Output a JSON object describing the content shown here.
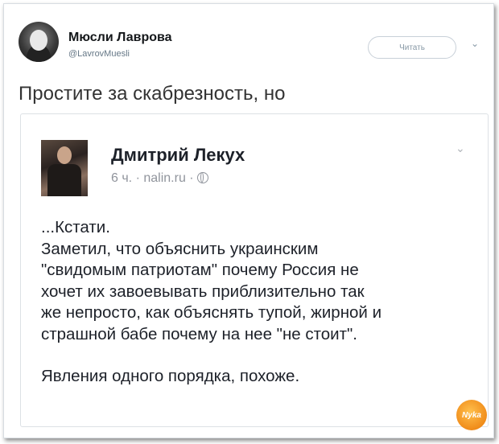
{
  "tweet": {
    "author_name": "Мюсли Лаврова",
    "author_handle": "@LavrovMuesli",
    "follow_label": "Читать",
    "caret": "⌄",
    "text": "Простите за скабрезность, но"
  },
  "quoted_post": {
    "author_name": "Дмитрий Лекух",
    "time": "6 ч.",
    "separator": "·",
    "source": "nalin.ru",
    "caret": "⌄",
    "body_lines": [
      "...Кстати.",
      "Заметил, что объяснить украинским",
      "\"свидомым патриотам\" почему Россия не",
      "хочет их завоевывать приблизительно так",
      "же непросто, как объяснять тупой, жирной и",
      "страшной бабе почему на нее \"не стоит\"."
    ],
    "last_line": "Явления одного порядка, похоже."
  },
  "watermark": "Nyka",
  "icons": {
    "avatar": "avatar-icon",
    "globe": "globe-icon",
    "caret": "chevron-down-icon"
  }
}
